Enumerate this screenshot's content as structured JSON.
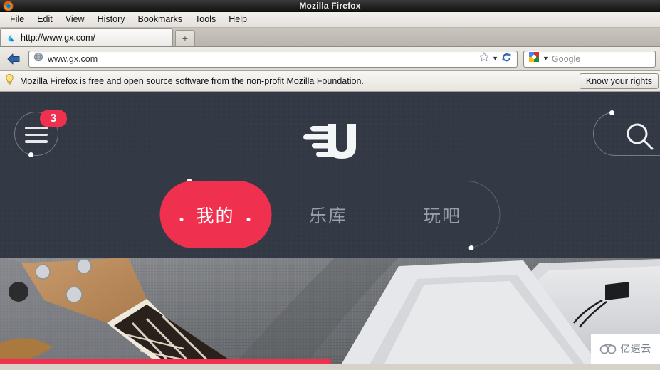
{
  "window": {
    "title": "Mozilla Firefox",
    "app_icon": "firefox-icon"
  },
  "menubar": {
    "items": [
      {
        "label": "File",
        "accel": "F"
      },
      {
        "label": "Edit",
        "accel": "E"
      },
      {
        "label": "View",
        "accel": "V"
      },
      {
        "label": "History",
        "accel": "s"
      },
      {
        "label": "Bookmarks",
        "accel": "B"
      },
      {
        "label": "Tools",
        "accel": "T"
      },
      {
        "label": "Help",
        "accel": "H"
      }
    ]
  },
  "tabstrip": {
    "tabs": [
      {
        "title": "http://www.gx.com/",
        "favicon": "page-favicon-icon",
        "active": true
      }
    ],
    "new_tab_label": "+"
  },
  "toolbar": {
    "back_icon": "back-arrow-icon",
    "url_value": "www.gx.com",
    "site_icon": "globe-icon",
    "bookmark_icon": "star-icon",
    "dropmarker_icon": "chevron-down-icon",
    "reload_icon": "reload-icon",
    "search_engine": "google-icon",
    "search_placeholder": "Google"
  },
  "notification": {
    "icon": "lightbulb-icon",
    "message": "Mozilla Firefox is free and open source software from the non-profit Mozilla Foundation.",
    "button_label": "Know your rights",
    "button_accel": "K"
  },
  "site": {
    "colors": {
      "header_bg": "#343a45",
      "accent_red": "#f0304f",
      "muted_text": "#9aa0ab"
    },
    "menu_button": {
      "icon": "hamburger-menu-icon",
      "badge_count": "3"
    },
    "logo": {
      "icon": "u-speed-logo-icon",
      "alt": "U"
    },
    "search_button": {
      "icon": "magnifier-icon"
    },
    "nav_tabs": [
      {
        "label": "我的",
        "active": true
      },
      {
        "label": "乐库",
        "active": false
      },
      {
        "label": "玩吧",
        "active": false
      }
    ],
    "hero": {
      "alt": "ukulele headstock on grey fabric with notebooks",
      "progress_bar_color": "#f0304f"
    },
    "watermark": {
      "icon": "cloud-icon",
      "text": "亿速云"
    }
  }
}
